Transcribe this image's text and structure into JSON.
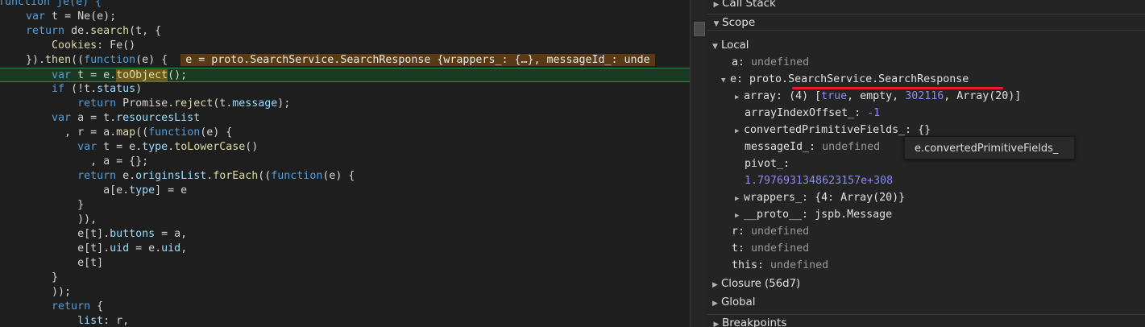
{
  "code": {
    "l1": "function je(e) {",
    "l2a": "    var",
    "l2b": " t = Ne(e);",
    "l3a": "    return",
    "l3b": " de.",
    "l3c": "search",
    "l3d": "(t, {",
    "l4a": "        Cookies",
    "l4b": ": Fe()",
    "l5a": "    }).",
    "l5b": "then",
    "l5c": "((",
    "l5d": "function",
    "l5e": "(e) {  ",
    "l5f": "e = proto.SearchService.SearchResponse {wrappers_: {…}, messageId_: unde",
    "l6a": "        var",
    "l6b": " t = e.",
    "l6c": "toObject",
    "l6d": "();",
    "l7a": "        if",
    "l7b": " (!t.",
    "l7c": "status",
    "l7d": ")",
    "l8a": "            return",
    "l8b": " Promise.",
    "l8c": "reject",
    "l8d": "(t.",
    "l8e": "message",
    "l8f": ");",
    "l9a": "        var",
    "l9b": " a = t.",
    "l9c": "resourcesList",
    "l10a": "          , r = a.",
    "l10b": "map",
    "l10c": "((",
    "l10d": "function",
    "l10e": "(e) {",
    "l11a": "            var",
    "l11b": " t = e.",
    "l11c": "type",
    "l11d": ".",
    "l11e": "toLowerCase",
    "l11f": "()",
    "l12": "              , a = {};",
    "l13a": "            return",
    "l13b": " e.",
    "l13c": "originsList",
    "l13d": ".",
    "l13e": "forEach",
    "l13f": "((",
    "l13g": "function",
    "l13h": "(e) {",
    "l14a": "                a[e.",
    "l14b": "type",
    "l14c": "] = e",
    "l15": "            }",
    "l16": "            )),",
    "l17a": "            e[t].",
    "l17b": "buttons",
    "l17c": " = a,",
    "l18a": "            e[t].",
    "l18b": "uid",
    "l18c": " = e.",
    "l18d": "uid",
    "l18e": ",",
    "l19": "            e[t]",
    "l20": "        }",
    "l21": "        ));",
    "l22a": "        return",
    "l22b": " {",
    "l23a": "            list",
    "l23b": ": r,"
  },
  "panel": {
    "call_stack": "Call Stack",
    "scope": "Scope",
    "local": "Local",
    "a_key": "a:",
    "a_val": "undefined",
    "e_key": "e:",
    "e_val": "proto.SearchService.SearchResponse",
    "array_key": "array:",
    "array_pre": "(4) [",
    "array_true": "true",
    "array_mid": ", empty, ",
    "array_num": "302116",
    "array_post": ", Array(20)]",
    "offset_key": "arrayIndexOffset_:",
    "offset_val": "-1",
    "conv_key": "convertedPrimitiveFields_:",
    "conv_val": "{}",
    "msg_key": "messageId_:",
    "msg_val": "undefined",
    "pivot_key": "pivot_:",
    "pivot_val": "1.7976931348623157e+308",
    "wrap_key": "wrappers_:",
    "wrap_val": "{4: Array(20)}",
    "proto_key": "__proto__:",
    "proto_val": "jspb.Message",
    "r_key": "r:",
    "r_val": "undefined",
    "t_key": "t:",
    "t_val": "undefined",
    "this_key": "this:",
    "this_val": "undefined",
    "closure": "Closure (56d7)",
    "global": "Global",
    "breakpoints": "Breakpoints",
    "tooltip": "e.convertedPrimitiveFields_"
  },
  "colors": {
    "highlight_border": "#2d8a4a",
    "inline_value_bg": "#5a3a12",
    "annotation_red": "#e8192c"
  }
}
